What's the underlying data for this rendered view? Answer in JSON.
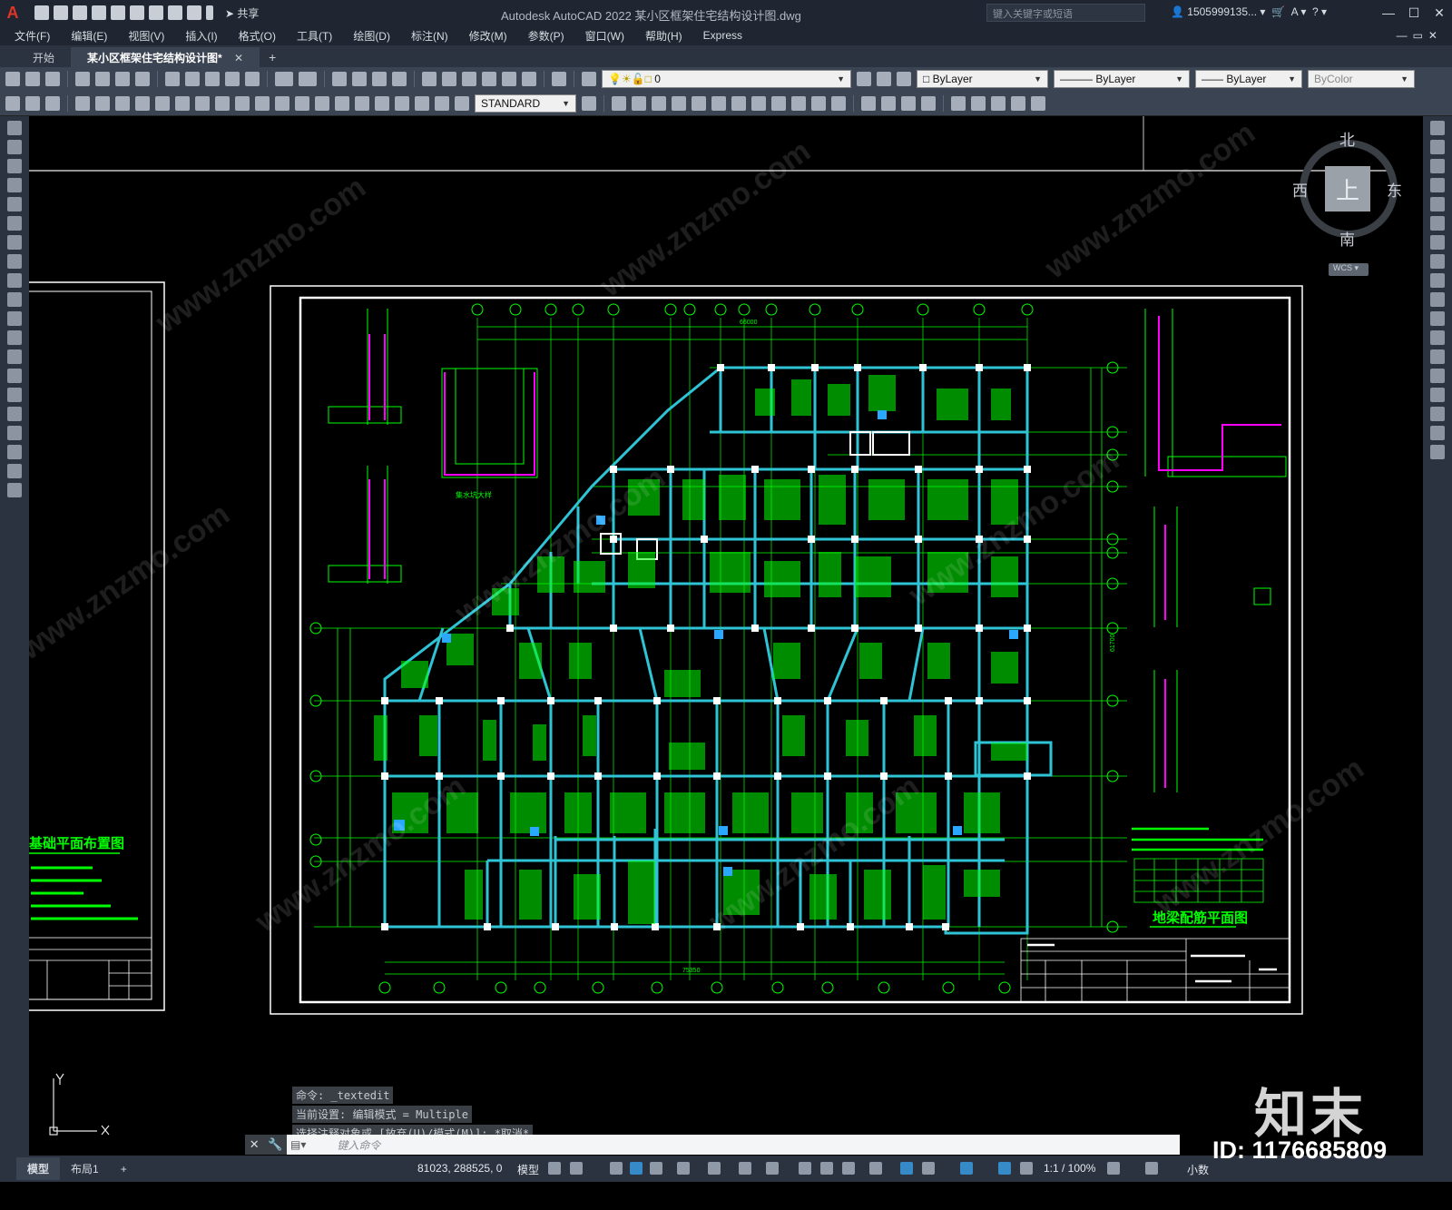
{
  "titlebar": {
    "app_letter": "A",
    "share_label": "共享",
    "window_title": "Autodesk AutoCAD 2022    某小区框架住宅结构设计图.dwg",
    "search_placeholder": "键入关键字或短语",
    "user": "1505999135..."
  },
  "menu": [
    "文件(F)",
    "编辑(E)",
    "视图(V)",
    "插入(I)",
    "格式(O)",
    "工具(T)",
    "绘图(D)",
    "标注(N)",
    "修改(M)",
    "参数(P)",
    "窗口(W)",
    "帮助(H)",
    "Express"
  ],
  "tabs": {
    "start": "开始",
    "doc": "某小区框架住宅结构设计图*"
  },
  "properties": {
    "layer": "0",
    "color": "ByLayer",
    "linetype": "ByLayer",
    "lineweight": "ByLayer",
    "plotstyle": "ByColor",
    "textstyle": "STANDARD"
  },
  "viewcube": {
    "north": "北",
    "south": "南",
    "east": "东",
    "west": "西",
    "face": "上",
    "wcs": "WCS"
  },
  "drawing": {
    "main_title": "地梁配筋平面图",
    "left_sheet_title": "基础平面布置图",
    "pit_label": "集水坑大样",
    "total_dim_bottom": "75350",
    "total_dim_top": "66000",
    "total_dim_right": "61700"
  },
  "command": {
    "history": [
      "命令: _textedit",
      "当前设置: 编辑模式 = Multiple",
      "选择注释对象或 [放弃(U)/模式(M)]: *取消*"
    ],
    "prompt": "键入命令"
  },
  "status": {
    "layout_tabs": [
      "模型",
      "布局1"
    ],
    "coords": "81023, 288525, 0",
    "mode": "模型",
    "scale": "1:1 / 100%",
    "units": "小数"
  },
  "watermark": {
    "logo": "知末",
    "id": "ID: 1176685809",
    "site": "www.znzmo.com"
  },
  "colors": {
    "beam": "#2ec4d6",
    "rebar": "#00ff00",
    "frame": "#ffffff",
    "axis": "#00ff00"
  }
}
